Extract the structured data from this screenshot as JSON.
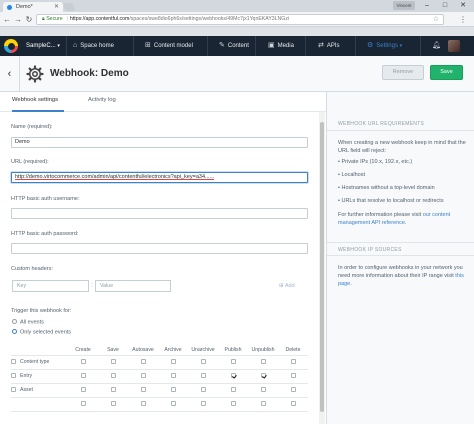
{
  "browser": {
    "tab_title": "Demo*",
    "window_badge": "Vincent",
    "secure_label": "Secure",
    "url_host": "https://app.contentful.com",
    "url_path": "/spaces/swe8dio6ph6s/settings/webhooks/49Mc7jx1YqnEKAY3LNGzi"
  },
  "appbar": {
    "space": "SampleC...",
    "nav": [
      "Space home",
      "Content model",
      "Content",
      "Media",
      "APIs",
      "Settings"
    ]
  },
  "entity": {
    "title": "Webhook: Demo",
    "remove_label": "Remove",
    "save_label": "Save"
  },
  "tabs": [
    "Webhook settings",
    "Activity log"
  ],
  "form": {
    "name_label": "Name (required):",
    "name_value": "Demo",
    "url_label": "URL (required):",
    "url_value": "http://demo.virtocommerce.com/admin/api/contentful/electronics?api_key=a34......",
    "user_label": "HTTP basic auth username:",
    "user_value": "",
    "pass_label": "HTTP basic auth password:",
    "pass_value": "",
    "headers_label": "Custom headers:",
    "key_placeholder": "Key",
    "value_placeholder": "Value",
    "add_label": "Add",
    "trigger_label": "Trigger this webhook for:",
    "radio_all": "All events",
    "radio_selected": "Only selected events"
  },
  "events": {
    "columns": [
      "Create",
      "Save",
      "Autosave",
      "Archive",
      "Unarchive",
      "Publish",
      "Unpublish",
      "Delete"
    ],
    "rows": [
      {
        "name": "Content type",
        "checked": [
          false,
          false,
          false,
          false,
          false,
          false,
          false,
          false
        ]
      },
      {
        "name": "Entry",
        "checked": [
          false,
          false,
          false,
          false,
          false,
          true,
          true,
          false
        ]
      },
      {
        "name": "Asset",
        "checked": [
          false,
          false,
          false,
          false,
          false,
          false,
          false,
          false
        ]
      }
    ],
    "footer_checked": [
      false,
      false,
      false,
      false,
      false,
      false,
      false,
      false
    ]
  },
  "sidebar": {
    "req_heading": "WEBHOOK URL REQUIREMENTS",
    "req_intro": "When creating a new webhook keep in mind that the URL field will reject:",
    "req_items": [
      "Private IPs (10.x, 192.x, etc.)",
      "Localhost",
      "Hostnames without a top-level domain",
      "URLs that resolve to localhost or redirects"
    ],
    "req_more_prefix": "For further information please visit ",
    "req_more_link": "our content management API reference",
    "req_more_suffix": ".",
    "ip_heading": "WEBHOOK IP SOURCES",
    "ip_text": "In order to configure webhooks in your network you need more information about their IP range visit ",
    "ip_link": "this page",
    "ip_suffix": "."
  },
  "colors": {
    "appbar_bg": "#192532",
    "accent_blue": "#3c80cf",
    "save_green": "#21b36b"
  }
}
